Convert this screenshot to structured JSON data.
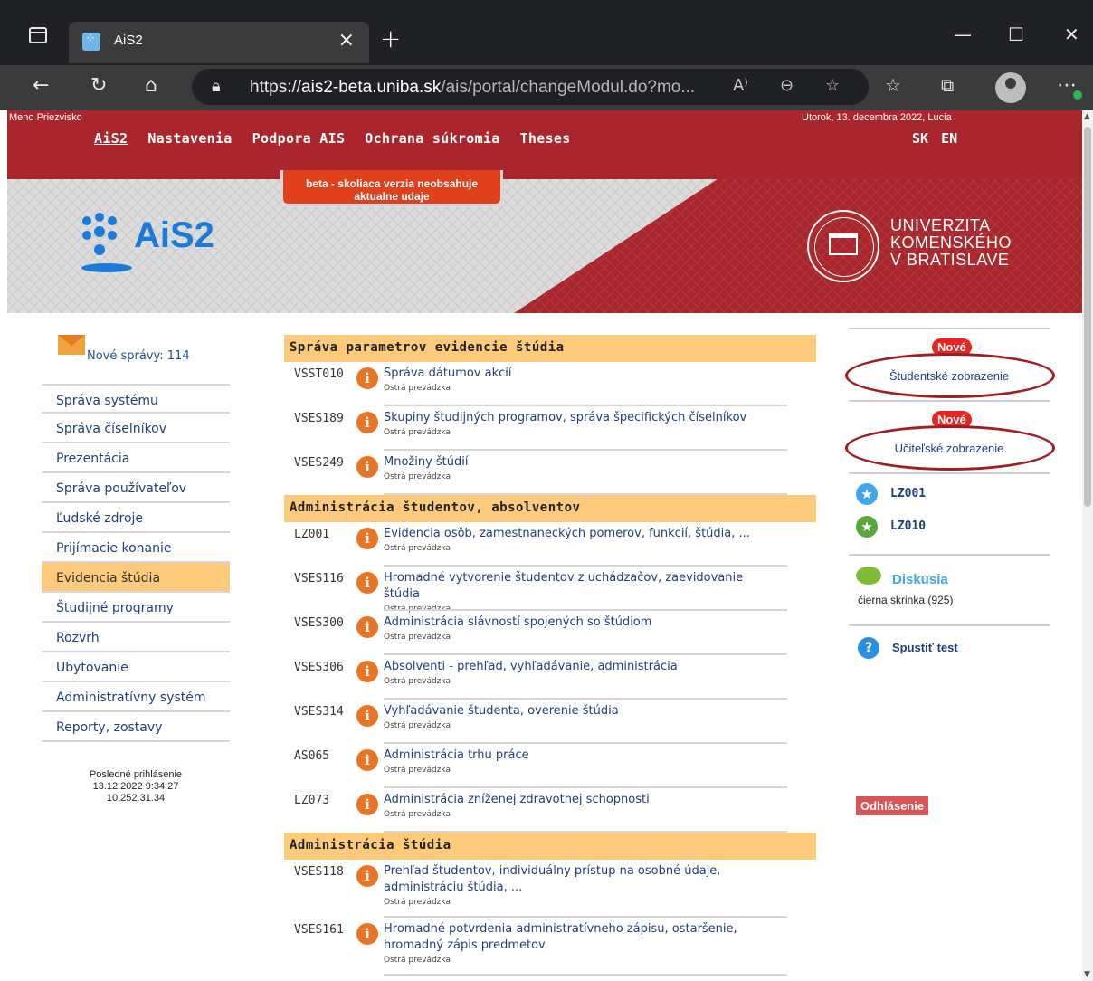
{
  "browser": {
    "tab_title": "AiS2",
    "url_scheme": "https://",
    "url_host": "ais2-beta.uniba.sk",
    "url_path": "/ais/portal/changeModul.do?mo..."
  },
  "header": {
    "user_name": "Meno Priezvisko",
    "date_line": "Utorok, 13. decembra 2022, Lucia",
    "menu": [
      "AiS2",
      "Nastavenia",
      "Podpora AIS",
      "Ochrana súkromia",
      "Theses"
    ],
    "languages": [
      "SK",
      "EN"
    ]
  },
  "banner": {
    "beta_notice": "beta - skoliaca verzia neobsahuje aktualne udaje",
    "logo_text": "AiS2",
    "university": [
      "UNIVERZITA",
      "KOMENSKÉHO",
      "V BRATISLAVE"
    ]
  },
  "sidebar": {
    "messages": "Nové správy: 114",
    "items": [
      "Správa systému",
      "Správa číselníkov",
      "Prezentácia",
      "Správa používateľov",
      "Ľudské zdroje",
      "Prijímacie konanie",
      "Evidencia štúdia",
      "Študijné programy",
      "Rozvrh",
      "Ubytovanie",
      "Administratívny systém",
      "Reporty, zostavy"
    ],
    "active_item": "Evidencia štúdia",
    "last_login_label": "Posledné prihlásenie",
    "last_login_time": "13.12.2022 9:34:27",
    "last_login_ip": "10.252.31.34"
  },
  "main": {
    "sections": [
      {
        "title": "Správa parametrov evidencie štúdia",
        "rows": [
          {
            "code": "VSST010",
            "title": "Správa dátumov akcií",
            "sub": "Ostrá prevádzka"
          },
          {
            "code": "VSES189",
            "title": "Skupiny študijných programov, správa špecifických číselníkov",
            "sub": "Ostrá prevádzka"
          },
          {
            "code": "VSES249",
            "title": "Množiny štúdií",
            "sub": "Ostrá prevádzka"
          }
        ]
      },
      {
        "title": "Administrácia študentov, absolventov",
        "rows": [
          {
            "code": "LZ001",
            "title": "Evidencia osôb, zamestnaneckých pomerov, funkcií, štúdia, ...",
            "sub": "Ostrá prevádzka"
          },
          {
            "code": "VSES116",
            "title": "Hromadné vytvorenie študentov z uchádzačov, zaevidovanie štúdia",
            "sub": "Ostrá prevádzka"
          },
          {
            "code": "VSES300",
            "title": "Administrácia slávností spojených so štúdiom",
            "sub": "Ostrá prevádzka"
          },
          {
            "code": "VSES306",
            "title": "Absolventi - prehľad, vyhľadávanie, administrácia",
            "sub": "Ostrá prevádzka"
          },
          {
            "code": "VSES314",
            "title": "Vyhľadávanie študenta, overenie štúdia",
            "sub": "Ostrá prevádzka"
          },
          {
            "code": "AS065",
            "title": "Administrácia trhu práce",
            "sub": "Ostrá prevádzka"
          },
          {
            "code": "LZ073",
            "title": "Administrácia zníženej zdravotnej schopnosti",
            "sub": "Ostrá prevádzka"
          }
        ]
      },
      {
        "title": "Administrácia štúdia",
        "rows": [
          {
            "code": "VSES118",
            "title": "Prehľad študentov, individuálny prístup na osobné údaje, administráciu štúdia, ...",
            "sub": "Ostrá prevádzka"
          },
          {
            "code": "VSES161",
            "title": "Hromadné potvrdenia administratívneho zápisu, ostaršenie, hromadný zápis predmetov",
            "sub": "Ostrá prevádzka"
          }
        ]
      }
    ]
  },
  "right": {
    "new_badge": "Nové",
    "student_view": "Študentské zobrazenie",
    "teacher_view": "Učiteľské zobrazenie",
    "favorites": [
      "LZ001",
      "LZ010"
    ],
    "discussion_title": "Diskusia",
    "discussion_sub": "čierna skrinka (925)",
    "test_label": "Spustiť test",
    "logout_label": "Odhlásenie"
  },
  "colors": {
    "header_red": "#a8262c",
    "section_orange": "#fdc97a",
    "link_blue": "#1f3f7a",
    "badge_red": "#e9251f"
  }
}
